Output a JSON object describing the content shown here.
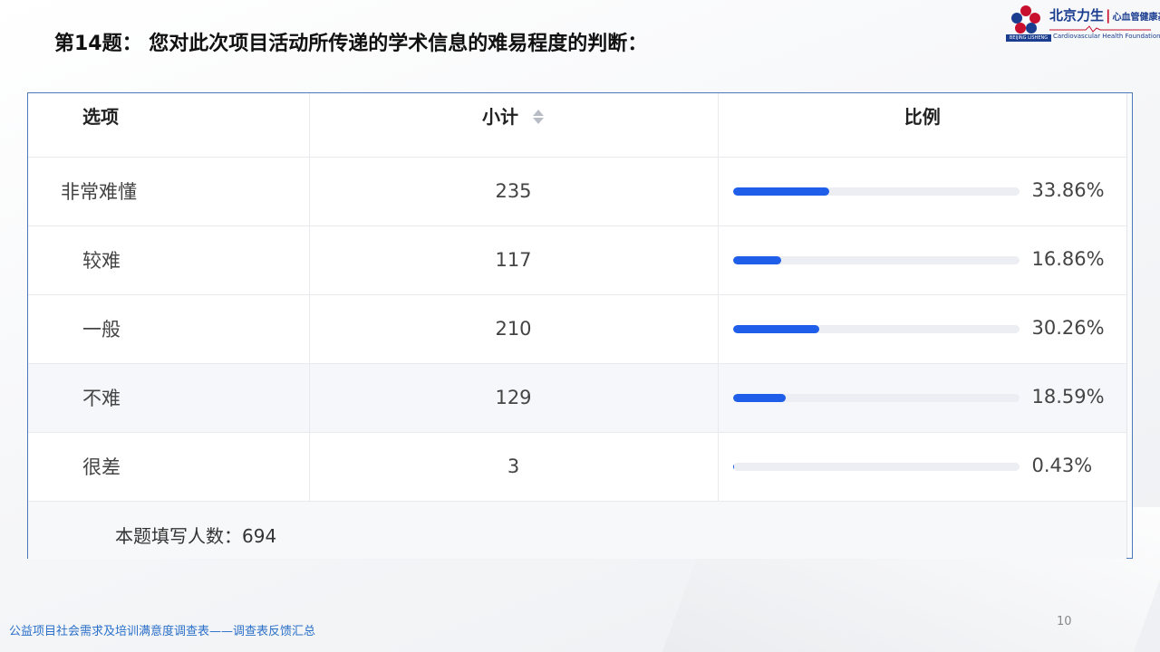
{
  "page": {
    "title": "第14题：  您对此次项目活动所传递的学术信息的难易程度的判断：",
    "page_number": "10",
    "footer_caption": "公益项目社会需求及培训满意度调查表——调查表反馈汇总"
  },
  "logo": {
    "cn_left": "北京力生",
    "cn_right": "心血管健康基金会",
    "en": "Cardiovascular Health Foundation",
    "tag": "BEIJING LISHENG"
  },
  "table": {
    "headers": {
      "option": "选项",
      "count": "小计",
      "ratio": "比例"
    },
    "rows": [
      {
        "option": "非常难懂",
        "count": "235",
        "ratio_label": "33.86%",
        "ratio": 33.86
      },
      {
        "option": "较难",
        "count": "117",
        "ratio_label": "16.86%",
        "ratio": 16.86
      },
      {
        "option": "一般",
        "count": "210",
        "ratio_label": "30.26%",
        "ratio": 30.26
      },
      {
        "option": "不难",
        "count": "129",
        "ratio_label": "18.59%",
        "ratio": 18.59
      },
      {
        "option": "很差",
        "count": "3",
        "ratio_label": "0.43%",
        "ratio": 0.43
      }
    ],
    "summary_label": "本题填写人数：694"
  },
  "colors": {
    "bar": "#1e5ee8",
    "track": "#eceef3",
    "border": "#4a78b8"
  }
}
